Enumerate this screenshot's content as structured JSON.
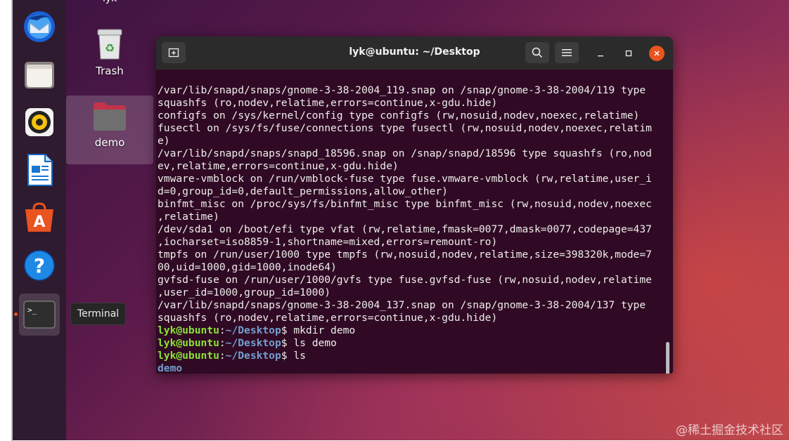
{
  "top_label": "lyk",
  "desktop_icons": [
    {
      "name": "Trash"
    },
    {
      "name": "demo"
    }
  ],
  "dock": {
    "items": [
      "Thunderbird",
      "Files",
      "Rhythmbox",
      "LibreOffice Writer",
      "Ubuntu Software",
      "Help",
      "Terminal"
    ],
    "tooltip": "Terminal"
  },
  "window": {
    "title": "lyk@ubuntu: ~/Desktop"
  },
  "terminal": {
    "output_lines": [
      "/var/lib/snapd/snaps/gnome-3-38-2004_119.snap on /snap/gnome-3-38-2004/119 type",
      "squashfs (ro,nodev,relatime,errors=continue,x-gdu.hide)",
      "configfs on /sys/kernel/config type configfs (rw,nosuid,nodev,noexec,relatime)",
      "fusectl on /sys/fs/fuse/connections type fusectl (rw,nosuid,nodev,noexec,relatim",
      "e)",
      "/var/lib/snapd/snaps/snapd_18596.snap on /snap/snapd/18596 type squashfs (ro,nod",
      "ev,relatime,errors=continue,x-gdu.hide)",
      "vmware-vmblock on /run/vmblock-fuse type fuse.vmware-vmblock (rw,relatime,user_i",
      "d=0,group_id=0,default_permissions,allow_other)",
      "binfmt_misc on /proc/sys/fs/binfmt_misc type binfmt_misc (rw,nosuid,nodev,noexec",
      ",relatime)",
      "/dev/sda1 on /boot/efi type vfat (rw,relatime,fmask=0077,dmask=0077,codepage=437",
      ",iocharset=iso8859-1,shortname=mixed,errors=remount-ro)",
      "tmpfs on /run/user/1000 type tmpfs (rw,nosuid,nodev,relatime,size=398320k,mode=7",
      "00,uid=1000,gid=1000,inode64)",
      "gvfsd-fuse on /run/user/1000/gvfs type fuse.gvfsd-fuse (rw,nosuid,nodev,relatime",
      ",user_id=1000,group_id=1000)",
      "/var/lib/snapd/snaps/gnome-3-38-2004_137.snap on /snap/gnome-3-38-2004/137 type",
      "squashfs (ro,nodev,relatime,errors=continue,x-gdu.hide)"
    ],
    "prompt_user": "lyk@ubuntu",
    "prompt_sep": ":",
    "prompt_path": "~/Desktop",
    "prompt_end": "$",
    "commands": [
      "mkdir demo",
      "ls demo",
      "ls"
    ],
    "ls_result": "demo"
  },
  "watermark": "@稀土掘金技术社区"
}
